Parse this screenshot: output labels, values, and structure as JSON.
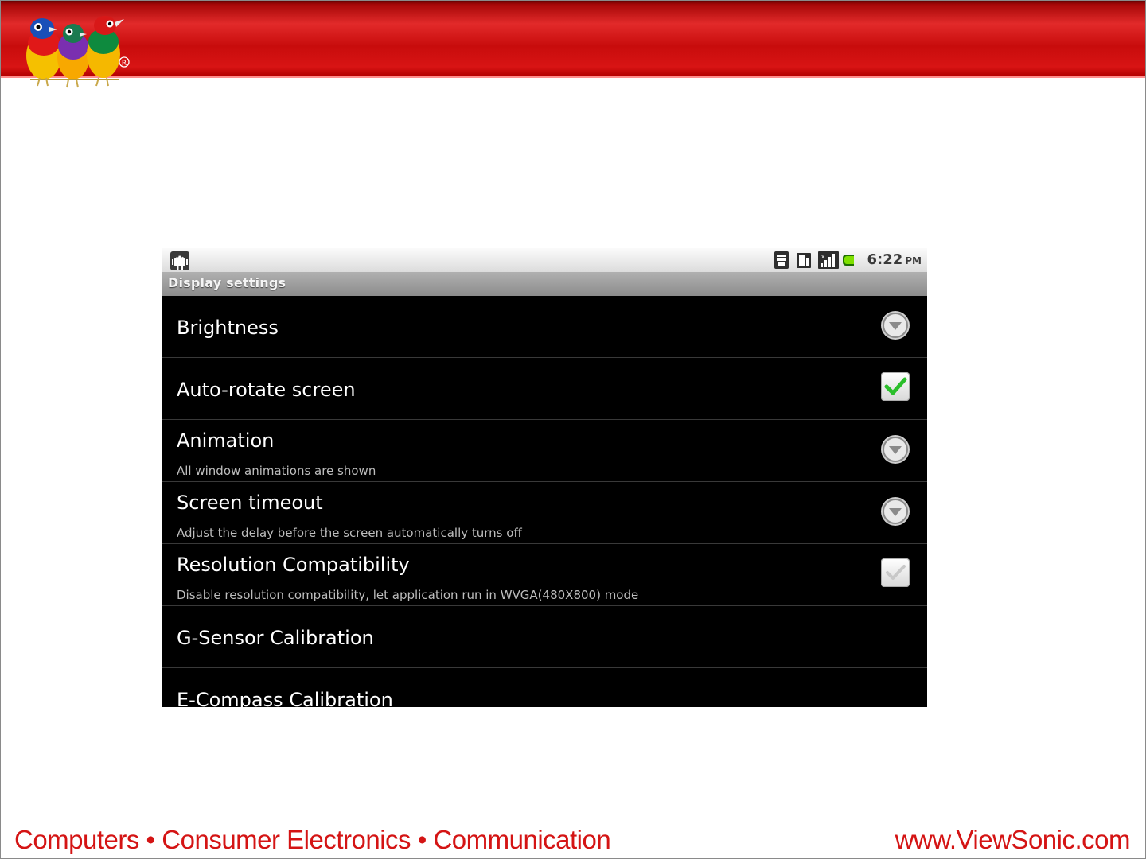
{
  "slide": {
    "brand_color": "#d41414",
    "logo": "viewsonic-birds-logo",
    "footer_left": "Computers • Consumer Electronics • Communication",
    "footer_right": "www.ViewSonic.com"
  },
  "device": {
    "statusbar": {
      "notification_icon": "android-debug-icon",
      "icons": [
        "sd-card-icon",
        "sim-card-icon",
        "signal-strength-icon",
        "battery-icon"
      ],
      "time": "6:22",
      "ampm": "PM"
    },
    "title": "Display settings",
    "settings": [
      {
        "title": "Brightness",
        "summary": "",
        "control": "dropdown"
      },
      {
        "title": "Auto-rotate screen",
        "summary": "",
        "control": "checkbox",
        "checked": true
      },
      {
        "title": "Animation",
        "summary": "All window animations are shown",
        "control": "dropdown"
      },
      {
        "title": "Screen timeout",
        "summary": "Adjust the delay before the screen automatically turns off",
        "control": "dropdown"
      },
      {
        "title": "Resolution Compatibility",
        "summary": "Disable resolution compatibility, let application run in WVGA(480X800) mode",
        "control": "checkbox",
        "checked": false
      },
      {
        "title": "G-Sensor Calibration",
        "summary": "",
        "control": "none"
      },
      {
        "title": "E-Compass Calibration",
        "summary": "",
        "control": "none"
      }
    ],
    "colors": {
      "check_green": "#2bbf2b",
      "background": "#000000",
      "divider": "#393939"
    }
  }
}
